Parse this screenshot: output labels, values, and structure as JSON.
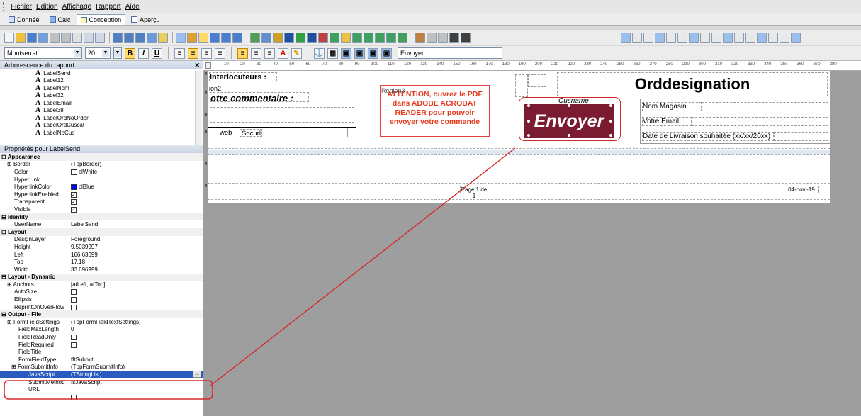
{
  "menu": {
    "items": [
      "Fichier",
      "Edition",
      "Affichage",
      "Rapport",
      "Aide"
    ]
  },
  "tabs": [
    {
      "label": "Donnée"
    },
    {
      "label": "Calc"
    },
    {
      "label": "Conception",
      "active": true
    },
    {
      "label": "Aperçu"
    }
  ],
  "format_toolbar": {
    "font_name": "Montserrat",
    "font_size": "20",
    "text_value": "Envoyer"
  },
  "tree": {
    "header": "Arborescence du rapport",
    "items": [
      "LabelSend",
      "Label12",
      "LabelNom",
      "Label32",
      "LabelEmail",
      "Label38",
      "LabelOrdNoOrder",
      "LabelOrdCuscat",
      "LabelNoCus"
    ]
  },
  "properties": {
    "header": "Propriétés pour LabelSend",
    "rows": [
      {
        "k": "Appearance",
        "cat": true
      },
      {
        "k": "Border",
        "v": "(TppBorder)",
        "expand": true
      },
      {
        "k": "Color",
        "v": "clWhite",
        "color": "#ffffff"
      },
      {
        "k": "HyperLink",
        "v": ""
      },
      {
        "k": "HyperlinkColor",
        "v": "clBlue",
        "color": "#0000ff"
      },
      {
        "k": "HyperlinkEnabled",
        "check": true
      },
      {
        "k": "Transparent",
        "check": true
      },
      {
        "k": "Visible",
        "check": true
      },
      {
        "k": "Identity",
        "cat": true
      },
      {
        "k": "UserName",
        "v": "LabelSend"
      },
      {
        "k": "Layout",
        "cat": true
      },
      {
        "k": "DesignLayer",
        "v": "Foreground"
      },
      {
        "k": "Height",
        "v": "9.5039997"
      },
      {
        "k": "Left",
        "v": "166.63699"
      },
      {
        "k": "Top",
        "v": "17.18"
      },
      {
        "k": "Width",
        "v": "33.696999"
      },
      {
        "k": "Layout - Dynamic",
        "cat": true
      },
      {
        "k": "Anchors",
        "v": "[atLeft, atTop]",
        "expand": true
      },
      {
        "k": "AutoSize",
        "check": false
      },
      {
        "k": "Ellipsis",
        "check": false
      },
      {
        "k": "ReprintOnOverFlow",
        "check": false
      },
      {
        "k": "Output - File",
        "cat": true
      },
      {
        "k": "FormFieldSettings",
        "v": "(TppFormFieldTextSettings)",
        "expand": true
      },
      {
        "k": "FieldMaxLength",
        "v": "0",
        "indent": true
      },
      {
        "k": "FieldReadOnly",
        "check": false,
        "indent": true
      },
      {
        "k": "FieldRequired",
        "check": false,
        "indent": true
      },
      {
        "k": "FieldTitle",
        "v": "",
        "indent": true
      },
      {
        "k": "FormFieldType",
        "v": "fftSubmit",
        "indent": true
      },
      {
        "k": "FormSubmitInfo",
        "v": "(TppFormSubmitInfo)",
        "expand": true,
        "indent": true
      },
      {
        "k": "JavaScript",
        "v": "(TStringList)",
        "indent2": true,
        "selected": true
      },
      {
        "k": "SubmitMethod",
        "v": "fsJavaScript",
        "indent2": true
      },
      {
        "k": "URL",
        "v": "",
        "indent2": true
      },
      {
        "k": "",
        "check": false
      }
    ]
  },
  "ruler": {
    "labels": [
      "10",
      "20",
      "30",
      "40",
      "50",
      "60",
      "70",
      "80",
      "90",
      "100",
      "110",
      "120",
      "130",
      "140",
      "150",
      "160",
      "170",
      "180",
      "190",
      "200",
      "210",
      "220",
      "230",
      "240",
      "250",
      "260",
      "270",
      "280",
      "290",
      "300",
      "310",
      "320",
      "330",
      "340",
      "350",
      "360",
      "370",
      "380"
    ]
  },
  "vruler": {
    "marks": [
      "0",
      "0",
      "0",
      "0",
      "0",
      "0"
    ]
  },
  "report": {
    "interlocuteurs": "Interlocuteurs :",
    "region2": "ion2",
    "commentaire": "otre commentaire :",
    "web": "web",
    "socurl": "Socurl",
    "region3": "Region3",
    "warning": "ATTENTION, ouvrez le PDF dans ADOBE ACROBAT READER pour pouvoir envoyer votre commande",
    "orddesignation": "Orddesignation",
    "cusname": "Cusname",
    "nom_magasin": "Nom Magasin",
    "votre_email": "Votre Email",
    "date_livraison": "Date de Livraison souhaitée (xx/xx/20xx)",
    "envoyer": "Envoyer",
    "page_label": "Page 1 de 1",
    "date": "04-nov.-19"
  },
  "colors": {
    "accent": "#7b1b31",
    "callout": "#d42a2a",
    "warning_text": "#e63a1e",
    "selection": "#2a5cc0"
  }
}
